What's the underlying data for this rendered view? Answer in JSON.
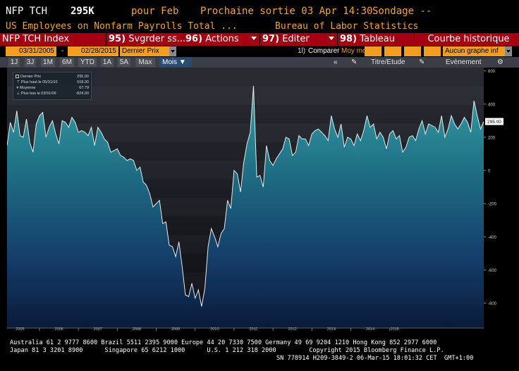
{
  "header": {
    "ticker": "NFP TCH",
    "value": "295K",
    "period_label": "pour Feb",
    "next_release": "Prochaine sortie 03 Apr 14:30",
    "survey": "Sondage --",
    "description": "US Employees on Nonfarm Payrolls Total ...",
    "source": "Bureau of Labor Statistics"
  },
  "menu": {
    "index": "NFP TCH Index",
    "save_num": "95)",
    "save": "Svgrder ss...",
    "actions_num": "96)",
    "actions": "Actions",
    "edit_num": "97)",
    "edit": "Editer",
    "table_num": "98)",
    "table": "Tableau",
    "history": "Courbe historique"
  },
  "controls": {
    "start_date": "03/31/2005",
    "dash": "-",
    "end_date": "02/28/2015",
    "price_field": "Dernier Prix",
    "compare_num": "1l)",
    "compare": "Comparer",
    "moving_avg": "Moy mob",
    "graph_select": "Aucun graphe inf"
  },
  "toolbar": {
    "ranges": [
      "1J",
      "3J",
      "1M",
      "6M",
      "YTD",
      "1A",
      "5A",
      "Max"
    ],
    "frequency": "Mois",
    "collapse": "«",
    "title_study": "Titre/Etude",
    "event": "Evènement"
  },
  "legend": {
    "last_price_label": "Dernier Prix",
    "last_price": "295.00",
    "high_label": "Plus haut le 05/31/10",
    "high": "518.00",
    "avg_label": "Moyenne",
    "avg": "67.79",
    "low_label": "Plus bas le 03/31/09",
    "low": "-824.00"
  },
  "chart_data": {
    "type": "area",
    "ylim": [
      -950,
      620
    ],
    "y_ticks": [
      600,
      400,
      200,
      0,
      -200,
      -400,
      -600,
      -800
    ],
    "x_ticks": [
      "2005",
      "2006",
      "2007",
      "2008",
      "2009",
      "2010",
      "2011",
      "2012",
      "2013",
      "2014",
      "2015"
    ],
    "last_value_label": "295.00",
    "colors": {
      "line": "#e8e8e8",
      "fill_top": "#2e8c95",
      "fill_bottom": "#0b1a38",
      "plot_bg_top": "#262a30",
      "plot_bg_bottom": "#0f1116",
      "last_value_bg": "#ffffff"
    },
    "series": [
      {
        "x_start": "2005-03",
        "values": [
          150,
          290,
          230,
          360,
          210,
          200,
          310,
          170,
          110,
          280,
          330,
          350,
          200,
          260,
          300,
          220,
          160,
          300,
          290,
          260,
          320,
          290,
          230,
          240,
          230,
          210,
          260,
          150,
          260,
          230,
          190,
          170,
          110,
          120,
          130,
          90,
          80,
          60,
          70,
          60,
          0,
          20,
          -70,
          -90,
          -140,
          -220,
          -200,
          -180,
          -320,
          -310,
          -450,
          -460,
          -520,
          -430,
          -580,
          -750,
          -760,
          -680,
          -770,
          -720,
          -820,
          -710,
          -460,
          -350,
          -400,
          -460,
          -380,
          -350,
          -180,
          -230,
          0,
          -20,
          -130,
          50,
          160,
          230,
          510,
          -40,
          -30,
          -100,
          150,
          60,
          30,
          70,
          100,
          130,
          200,
          190,
          90,
          110,
          210,
          190,
          190,
          150,
          220,
          240,
          250,
          230,
          210,
          180,
          330,
          250,
          200,
          280,
          140,
          200,
          190,
          150,
          220,
          180,
          240,
          330,
          260,
          280,
          190,
          230,
          200,
          130,
          220,
          240,
          190,
          210,
          110,
          140,
          200,
          210,
          180,
          250,
          300,
          220,
          280,
          270,
          260,
          230,
          330,
          200,
          250,
          330,
          280,
          250,
          280,
          320,
          290,
          230,
          420,
          330,
          250,
          295
        ]
      }
    ]
  },
  "footer": {
    "line1": "Australia 61 2 9777 8600 Brazil 5511 2395 9000 Europe 44 20 7330 7500 Germany 49 69 9204 1210 Hong Kong 852 2977 6000",
    "line2": "Japan 81 3 3201 8900      Singapore 65 6212 1000      U.S. 1 212 318 2000         Copyright 2015 Bloomberg Finance L.P.",
    "line3": "SN 778914 H209-3849-2 06-Mar-15 18:01:32 CET  GMT+1:00"
  }
}
